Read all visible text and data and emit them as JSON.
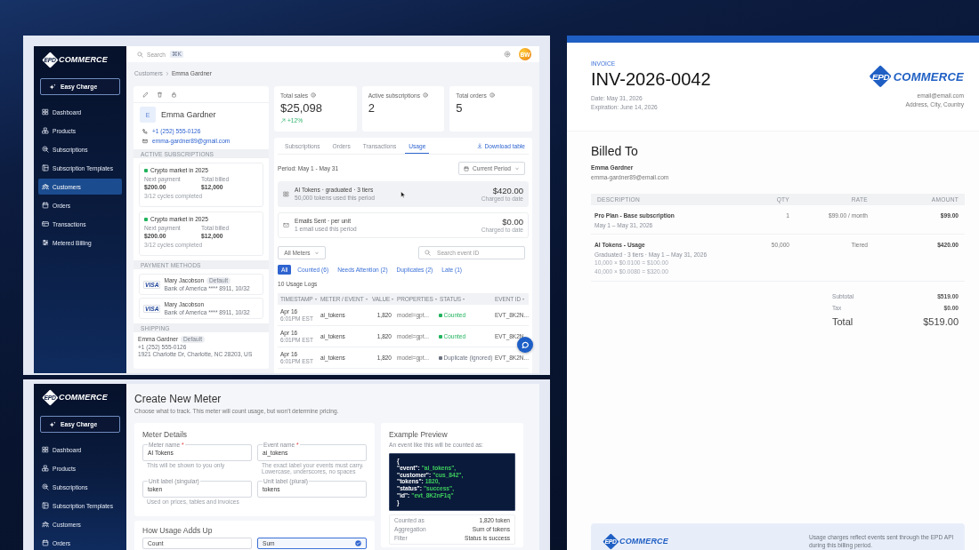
{
  "customer_window": {
    "sidebar": {
      "logo": {
        "mark": "EPD",
        "word": "COMMERCE"
      },
      "action": "Easy Charge",
      "items": [
        {
          "label": "Dashboard",
          "selected": false
        },
        {
          "label": "Products",
          "selected": false
        },
        {
          "label": "Subscriptions",
          "selected": false
        },
        {
          "label": "Subscription Templates",
          "selected": false
        },
        {
          "label": "Customers",
          "selected": true
        },
        {
          "label": "Orders",
          "selected": false
        },
        {
          "label": "Transactions",
          "selected": false
        },
        {
          "label": "Metered Billing",
          "selected": false
        }
      ]
    },
    "topbar": {
      "search_placeholder": "Search",
      "shortcut": "⌘K",
      "avatar": "BW"
    },
    "breadcrumb": [
      "Customers",
      "Emma Gardner"
    ],
    "profile": {
      "initial": "E",
      "name": "Emma Gardner",
      "phone": "+1 (252) 555-0126",
      "email": "emma-gardner89@gmail.com"
    },
    "subscriptions": {
      "heading": "ACTIVE SUBSCRIPTIONS",
      "items": [
        {
          "name": "Crypto market in 2025",
          "next_label": "Next payment",
          "next": "$200.00",
          "billed_label": "Total billed",
          "billed": "$12,000",
          "progress": "3/12 cycles completed"
        },
        {
          "name": "Crypto market in 2025",
          "next_label": "Next payment",
          "next": "$200.00",
          "billed_label": "Total billed",
          "billed": "$12,000",
          "progress": "3/12 cycles completed"
        }
      ]
    },
    "payment_methods": {
      "heading": "PAYMENT METHODS",
      "items": [
        {
          "brand": "VISA",
          "name": "Mary Jacobson",
          "badge": "Default",
          "details": "Bank of America **** 8911, 10/32"
        },
        {
          "brand": "VISA",
          "name": "Mary Jacobson",
          "details": "Bank of America **** 8911, 10/32"
        }
      ]
    },
    "shipping": {
      "heading": "SHIPPING",
      "name": "Emma Gardner",
      "badge": "Default",
      "phone": "+1 (252) 555-0126",
      "address": "1921 Charlotte Dr, Charlotte, NC 28203, US"
    },
    "stats": [
      {
        "label": "Total sales",
        "value": "$25,098",
        "trend": "+12%"
      },
      {
        "label": "Active subscriptions",
        "value": "2"
      },
      {
        "label": "Total orders",
        "value": "5"
      }
    ],
    "tabs": [
      {
        "label": "Subscriptions",
        "selected": false
      },
      {
        "label": "Orders",
        "selected": false
      },
      {
        "label": "Transactions",
        "selected": false
      },
      {
        "label": "Usage",
        "selected": true
      }
    ],
    "download": "Download table",
    "period": "Period: May 1 - May 31",
    "period_select": "Current Period",
    "meters": [
      {
        "name": "AI Tokens · graduated · 3 tiers",
        "usage": "50,000 tokens used this period",
        "amount": "$420.00",
        "note": "Charged to date",
        "selected": true
      },
      {
        "name": "Emails Sent · per unit",
        "usage": "1 email used this period",
        "amount": "$0.00",
        "note": "Charged to date",
        "selected": false
      }
    ],
    "meter_filter": "All Meters",
    "event_search_placeholder": "Search event ID",
    "filters": [
      {
        "label": "All",
        "selected": true
      },
      {
        "label": "Counted (6)",
        "selected": false
      },
      {
        "label": "Needs Attention (2)",
        "selected": false
      },
      {
        "label": "Duplicates (2)",
        "selected": false
      },
      {
        "label": "Late (1)",
        "selected": false
      }
    ],
    "log_title": "10 Usage Logs",
    "table": {
      "columns": [
        "TIMESTAMP",
        "METER / EVENT",
        "VALUE",
        "PROPERTIES",
        "STATUS",
        "EVENT ID"
      ],
      "rows": [
        {
          "date": "Apr 16",
          "time": "6:01PM EST",
          "meter": "ai_tokens",
          "value": "1,820",
          "properties": "model=gpt...",
          "status": "Counted",
          "color": "#22b35e",
          "event_id": "EVT_8K2N..."
        },
        {
          "date": "Apr 16",
          "time": "6:01PM EST",
          "meter": "ai_tokens",
          "value": "1,820",
          "properties": "model=gpt...",
          "status": "Counted",
          "color": "#22b35e",
          "event_id": "EVT_8K2N"
        },
        {
          "date": "Apr 16",
          "time": "6:01PM EST",
          "meter": "ai_tokens",
          "value": "1,820",
          "properties": "model=gpt...",
          "status": "Duplicate (ignored)",
          "color": "#6b7280",
          "event_id": "EVT_8K2N..."
        }
      ]
    }
  },
  "meter_window": {
    "sidebar": {
      "logo": {
        "mark": "EPD",
        "word": "COMMERCE"
      },
      "action": "Easy Charge",
      "items": [
        {
          "label": "Dashboard",
          "selected": false
        },
        {
          "label": "Products",
          "selected": false
        },
        {
          "label": "Subscriptions",
          "selected": false
        },
        {
          "label": "Subscription Templates",
          "selected": false
        },
        {
          "label": "Customers",
          "selected": false
        },
        {
          "label": "Orders",
          "selected": false
        }
      ]
    },
    "title": "Create New Meter",
    "subtitle": "Choose what to track. This meter will count usage, but won't determine pricing.",
    "details": {
      "title": "Meter Details",
      "fields": [
        {
          "label": "Meter name",
          "required_mark": "*",
          "value": "AI Tokens",
          "help": "This will be shown to you only"
        },
        {
          "label": "Event name",
          "required_mark": "*",
          "value": "ai_tokens",
          "help": "The exact label your events must carry. Lowercase, underscores, no spaces"
        },
        {
          "label": "Unit label (singular)",
          "value": "token",
          "help": "Used on prices, tables and invoices"
        },
        {
          "label": "Unit label (plural)",
          "value": "tokens"
        }
      ]
    },
    "aggregation": {
      "title": "How Usage Adds Up",
      "options": [
        {
          "label": "Count",
          "selected": false
        },
        {
          "label": "Sum",
          "selected": true
        }
      ]
    },
    "preview": {
      "title": "Example Preview",
      "subtitle": "An event like this will be counted as:",
      "code": [
        {
          "kind": "brace",
          "text": "{"
        },
        {
          "kind": "pair",
          "key": "\"event\":",
          "value": "\"ai_tokens\","
        },
        {
          "kind": "pair",
          "key": "\"customer\":",
          "value": "\"cus_842\","
        },
        {
          "kind": "pair",
          "key": "\"tokens\":",
          "value": "1820,"
        },
        {
          "kind": "pair",
          "key": "\"status\":",
          "value": "\"success\","
        },
        {
          "kind": "pair",
          "key": "\"id\":",
          "value": "\"evt_8K2nF1q\""
        },
        {
          "kind": "brace",
          "text": "}"
        }
      ],
      "summary": [
        {
          "label": "Counted as",
          "value": "1,820 token"
        },
        {
          "label": "Aggregation",
          "value": "Sum of tokens"
        },
        {
          "label": "Filter",
          "value": "Status is success"
        }
      ]
    }
  },
  "invoice": {
    "label": "INVOICE",
    "number": "INV-2026-0042",
    "dates": [
      "Date: May 31, 2026",
      "Expiration: June 14, 2026"
    ],
    "logo": {
      "mark": "EPD",
      "word": "COMMERCE"
    },
    "contact": [
      "email@email.com",
      "Address, City, Country"
    ],
    "billed_to": {
      "title": "Billed To",
      "name": "Emma Gardner",
      "email": "emma-gardner89@email.com"
    },
    "table": {
      "columns": [
        "DESCRIPTION",
        "QTY",
        "RATE",
        "AMOUNT"
      ],
      "rows": [
        {
          "description": "Pro Plan - Base subscription",
          "period": "May 1 – May 31, 2026",
          "qty": "1",
          "rate": "$99.00 / month",
          "amount": "$99.00"
        },
        {
          "description": "AI Tokens - Usage",
          "period": "Graduated · 3 tiers · May 1 – May 31, 2026",
          "tiers": [
            "10,000 × $0.0100 = $100.00",
            "40,000 × $0.0080 = $320.00"
          ],
          "qty": "50,000",
          "rate": "Tiered",
          "amount": "$420.00"
        }
      ]
    },
    "totals": [
      {
        "kind": "line",
        "label": "Subtotal",
        "value": "$519.00"
      },
      {
        "kind": "line",
        "label": "Tax",
        "value": "$0.00"
      },
      {
        "kind": "grand",
        "label": "Total",
        "value": "$519.00"
      }
    ],
    "footer": {
      "logo": {
        "mark": "EPD",
        "word": "COMMERCE"
      },
      "note": "Usage charges reflect events sent through the EPD API during this billing period."
    }
  }
}
